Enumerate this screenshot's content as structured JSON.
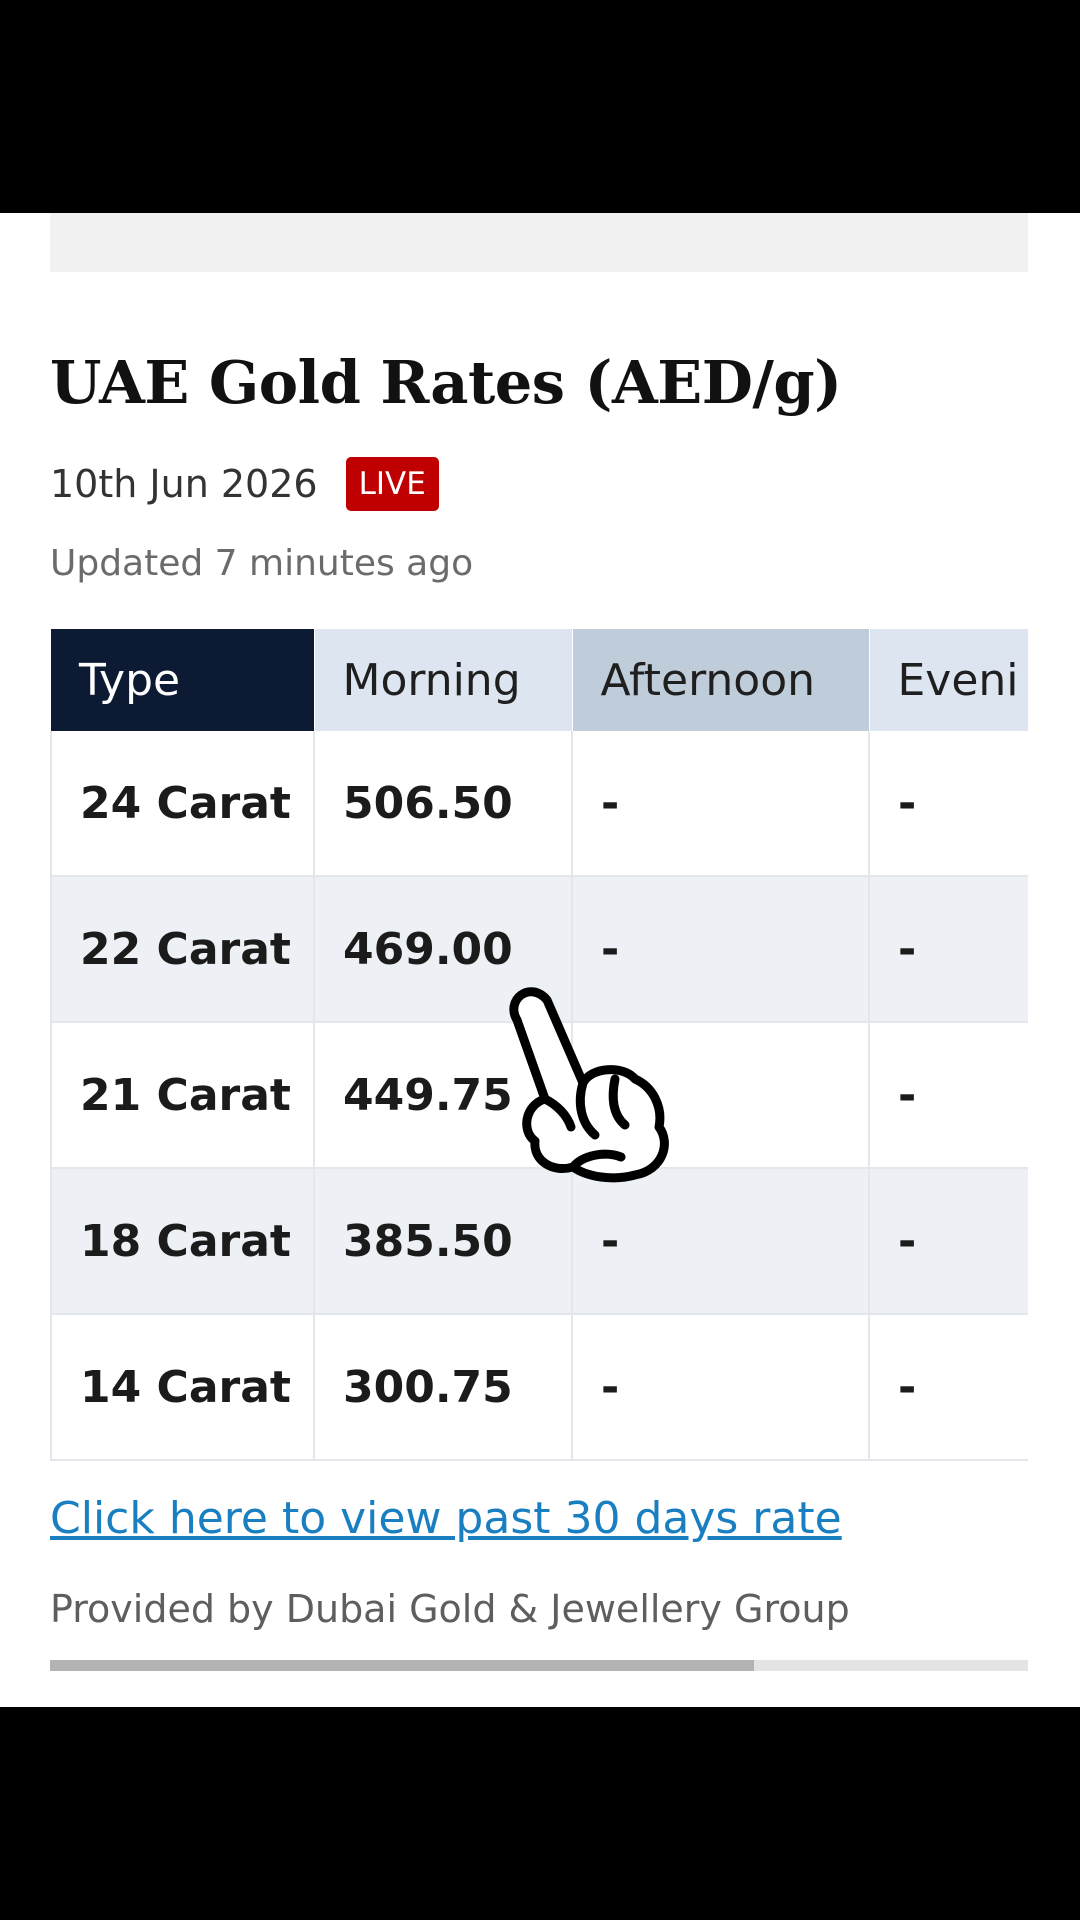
{
  "header": {
    "title": "UAE Gold Rates (AED/g)",
    "date": "10th Jun 2026",
    "live_badge": "LIVE",
    "updated": "Updated 7 minutes ago"
  },
  "table": {
    "columns": [
      "Type",
      "Morning",
      "Afternoon",
      "Eveni"
    ],
    "rows": [
      {
        "type": "24 Carat",
        "morning": "506.50",
        "afternoon": "-",
        "evening": "-"
      },
      {
        "type": "22 Carat",
        "morning": "469.00",
        "afternoon": "-",
        "evening": "-"
      },
      {
        "type": "21 Carat",
        "morning": "449.75",
        "afternoon": "-",
        "evening": "-"
      },
      {
        "type": "18 Carat",
        "morning": "385.50",
        "afternoon": "-",
        "evening": "-"
      },
      {
        "type": "14 Carat",
        "morning": "300.75",
        "afternoon": "-",
        "evening": "-"
      }
    ],
    "horizontal_scroll_fraction": 0.72
  },
  "footer": {
    "link_text": "Click here to view past 30 days rate",
    "provider": "Provided by Dubai Gold & Jewellery Group"
  },
  "colors": {
    "live_badge": "#c00000",
    "type_header": "#0c1a33",
    "link": "#1a7fc1"
  },
  "icons": {
    "pointer": "hand-pointer-icon"
  }
}
